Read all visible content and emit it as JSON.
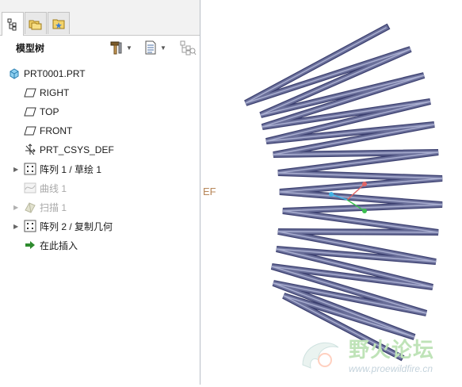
{
  "tabs": [
    {
      "icon": "model-tree-tab-icon"
    },
    {
      "icon": "folder-browser-tab-icon"
    },
    {
      "icon": "favorites-tab-icon"
    }
  ],
  "tree_header": {
    "title": "模型树",
    "settings_icon": "hammer-settings-icon",
    "show_icon": "list-show-icon",
    "filter_icon": "tree-filter-icon"
  },
  "tree": {
    "root": "PRT0001.PRT",
    "items": [
      {
        "label": "RIGHT",
        "icon": "datum-plane-icon"
      },
      {
        "label": "TOP",
        "icon": "datum-plane-icon"
      },
      {
        "label": "FRONT",
        "icon": "datum-plane-icon"
      },
      {
        "label": "PRT_CSYS_DEF",
        "icon": "coordinate-system-icon"
      },
      {
        "label": "阵列 1 / 草绘 1",
        "icon": "pattern-icon"
      },
      {
        "label": "曲线 1",
        "icon": "curve-icon"
      },
      {
        "label": "扫描 1",
        "icon": "sweep-icon"
      },
      {
        "label": "阵列 2 / 复制几何",
        "icon": "pattern-icon"
      },
      {
        "label": "在此插入",
        "icon": "insert-here-arrow-icon"
      }
    ]
  },
  "viewport": {
    "datum_label": "EF",
    "colors": {
      "model": "#6a6f9a",
      "model_shadow": "#3c4070",
      "model_highlight": "#a9aed0"
    }
  },
  "watermark": {
    "text": "野火论坛",
    "url": "www.proewildfire.cn"
  }
}
